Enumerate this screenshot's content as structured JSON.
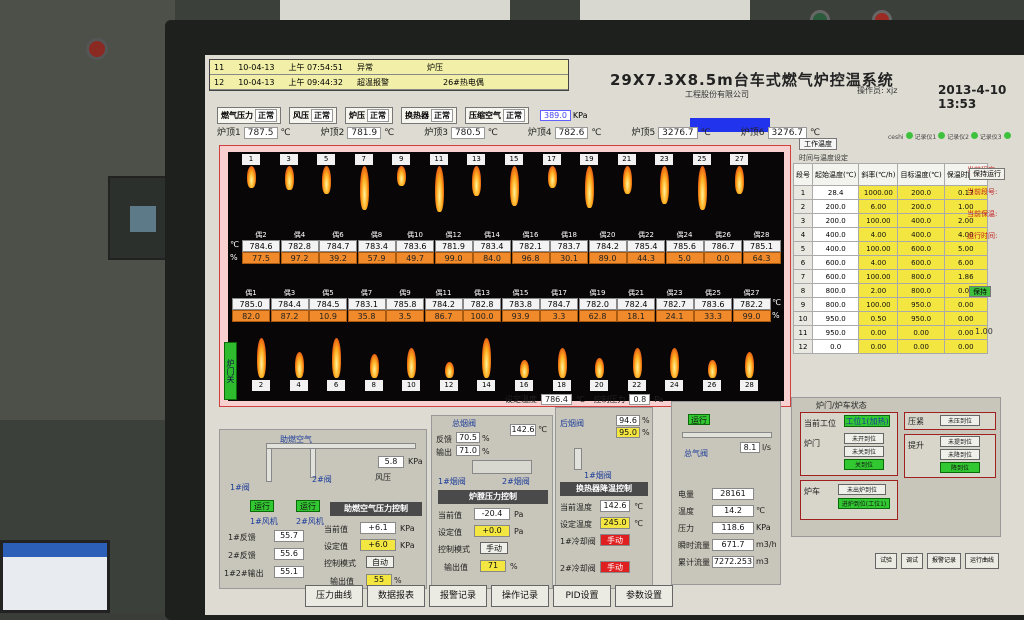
{
  "alarms": [
    {
      "no": "11",
      "date": "10-04-13",
      "time": "上午 07:54:51",
      "type": "异常",
      "source": "炉压"
    },
    {
      "no": "12",
      "date": "10-04-13",
      "time": "上午 09:44:32",
      "type": "超温报警",
      "source": "26#热电偶"
    }
  ],
  "header": {
    "title": "29X7.3X8.5m台车式燃气炉控温系统",
    "subtitle": "工程股份有限公司",
    "operator_label": "操作员:",
    "operator": "xjz",
    "datetime": "2013-4-10 13:53"
  },
  "status": [
    {
      "label": "燃气压力",
      "state": "正常"
    },
    {
      "label": "风压",
      "state": "正常"
    },
    {
      "label": "炉压",
      "state": "正常"
    },
    {
      "label": "换热器",
      "state": "正常"
    },
    {
      "label": "压缩空气",
      "state": "正常"
    }
  ],
  "kpa": {
    "value": "389.0",
    "unit": "KPa"
  },
  "zones": [
    {
      "label": "炉顶1",
      "value": "787.5",
      "unit": "℃"
    },
    {
      "label": "炉顶2",
      "value": "781.9",
      "unit": "℃"
    },
    {
      "label": "炉顶3",
      "value": "780.5",
      "unit": "℃"
    },
    {
      "label": "炉顶4",
      "value": "782.6",
      "unit": "℃"
    },
    {
      "label": "炉顶5",
      "value": "3276.7",
      "unit": "℃"
    },
    {
      "label": "炉顶6",
      "value": "3276.7",
      "unit": "℃"
    }
  ],
  "furnace": {
    "top_nozzles": [
      "1",
      "3",
      "5",
      "7",
      "9",
      "11",
      "13",
      "15",
      "17",
      "19",
      "21",
      "23",
      "25",
      "27"
    ],
    "bottom_nozzles": [
      "2",
      "4",
      "6",
      "8",
      "10",
      "12",
      "14",
      "16",
      "18",
      "20",
      "22",
      "24",
      "26",
      "28"
    ],
    "upper_tc": [
      {
        "label": "偶2",
        "t": "784.6",
        "p": "77.5"
      },
      {
        "label": "偶4",
        "t": "782.8",
        "p": "97.2"
      },
      {
        "label": "偶6",
        "t": "784.7",
        "p": "39.2"
      },
      {
        "label": "偶8",
        "t": "783.4",
        "p": "57.9"
      },
      {
        "label": "偶10",
        "t": "783.6",
        "p": "49.7"
      },
      {
        "label": "偶12",
        "t": "781.9",
        "p": "99.0"
      },
      {
        "label": "偶14",
        "t": "783.4",
        "p": "84.0"
      },
      {
        "label": "偶16",
        "t": "782.1",
        "p": "96.8"
      },
      {
        "label": "偶18",
        "t": "783.7",
        "p": "30.1"
      },
      {
        "label": "偶20",
        "t": "784.2",
        "p": "89.0"
      },
      {
        "label": "偶22",
        "t": "785.4",
        "p": "44.3"
      },
      {
        "label": "偶24",
        "t": "785.6",
        "p": "5.0"
      },
      {
        "label": "偶26",
        "t": "786.7",
        "p": "0.0"
      },
      {
        "label": "偶28",
        "t": "785.1",
        "p": "64.3"
      }
    ],
    "lower_tc": [
      {
        "label": "偶1",
        "t": "785.0",
        "p": "82.0"
      },
      {
        "label": "偶3",
        "t": "784.4",
        "p": "87.2"
      },
      {
        "label": "偶5",
        "t": "784.5",
        "p": "10.9"
      },
      {
        "label": "偶7",
        "t": "783.1",
        "p": "35.8"
      },
      {
        "label": "偶9",
        "t": "785.8",
        "p": "3.5"
      },
      {
        "label": "偶11",
        "t": "784.2",
        "p": "86.7"
      },
      {
        "label": "偶13",
        "t": "782.8",
        "p": "100.0"
      },
      {
        "label": "偶15",
        "t": "783.8",
        "p": "93.9"
      },
      {
        "label": "偶17",
        "t": "784.7",
        "p": "3.3"
      },
      {
        "label": "偶19",
        "t": "782.0",
        "p": "62.8"
      },
      {
        "label": "偶21",
        "t": "782.4",
        "p": "18.1"
      },
      {
        "label": "偶23",
        "t": "782.7",
        "p": "24.1"
      },
      {
        "label": "偶25",
        "t": "783.6",
        "p": "33.3"
      },
      {
        "label": "偶27",
        "t": "782.2",
        "p": "99.0"
      }
    ],
    "door_label": "炉门关",
    "unit_c": "℃",
    "unit_p": "%"
  },
  "set_temp": {
    "label": "设定温度",
    "value": "786.4",
    "unit": "℃",
    "press_label": "控制压力",
    "press": "0.8",
    "press_unit": "Pa"
  },
  "program": {
    "btn": "工作温度",
    "title": "时间与温度设定",
    "headers": [
      "段号",
      "起始温度(℃)",
      "斜率(℃/h)",
      "目标温度(℃)",
      "保温时间(h)"
    ],
    "rows": [
      [
        "1",
        "28.4",
        "1000.00",
        "200.0",
        "0.17"
      ],
      [
        "2",
        "200.0",
        "6.00",
        "200.0",
        "1.00"
      ],
      [
        "3",
        "200.0",
        "100.00",
        "400.0",
        "2.00"
      ],
      [
        "4",
        "400.0",
        "4.00",
        "400.0",
        "4.00"
      ],
      [
        "5",
        "400.0",
        "100.00",
        "600.0",
        "5.00"
      ],
      [
        "6",
        "600.0",
        "4.00",
        "600.0",
        "6.00"
      ],
      [
        "7",
        "600.0",
        "100.00",
        "800.0",
        "1.86"
      ],
      [
        "8",
        "800.0",
        "2.00",
        "800.0",
        "0.00"
      ],
      [
        "9",
        "800.0",
        "100.00",
        "950.0",
        "0.00"
      ],
      [
        "10",
        "950.0",
        "0.50",
        "950.0",
        "0.00"
      ],
      [
        "11",
        "950.0",
        "0.00",
        "0.00",
        "0.00"
      ],
      [
        "12",
        "0.0",
        "0.00",
        "0.00",
        "0.00"
      ]
    ],
    "side_labels": [
      "当前程序:",
      "当前段号:",
      "当前保温:",
      "运行时间:"
    ],
    "side_val": "1.00",
    "led_labels": [
      "ceshi",
      "记录仪1",
      "记录仪2",
      "记录仪3"
    ],
    "run_btn": "保持运行",
    "hold_btn": "保持"
  },
  "air": {
    "title": "助燃空气",
    "press": "5.8",
    "press_unit": "KPa",
    "press_label": "风压",
    "fan1": "1#风机",
    "fan2": "2#风机",
    "run1": "运行",
    "run2": "运行",
    "valve1": "1#阀",
    "valve2": "2#阀",
    "box_title": "助燃空气压力控制",
    "fb1_label": "1#反馈",
    "fb1": "55.7",
    "fb2_label": "2#反馈",
    "fb2": "55.6",
    "out_label": "1#2#输出",
    "out": "55.1",
    "cur_label": "当前值",
    "cur": "+6.1",
    "cur_unit": "KPa",
    "set_label": "设定值",
    "set": "+6.0",
    "set_unit": "KPa",
    "mode_label": "控制模式",
    "mode": "自动",
    "o_label": "输出值",
    "o": "55",
    "o_unit": "%"
  },
  "flue": {
    "title": "总烟阀",
    "fb_label": "反馈",
    "fb": "70.5",
    "fb_unit": "%",
    "out_label": "输出",
    "out": "71.0",
    "out_unit": "%",
    "temp": "142.6",
    "temp_unit": "℃",
    "valve": "1#烟阀",
    "valve2": "2#烟阀",
    "box_title": "炉膛压力控制",
    "cur_label": "当前值",
    "cur": "-20.4",
    "cur_unit": "Pa",
    "set_label": "设定值",
    "set": "+0.0",
    "set_unit": "Pa",
    "mode_label": "控制模式",
    "mode": "手动",
    "o_label": "输出值",
    "o": "71",
    "o_unit": "%"
  },
  "exchanger": {
    "title": "后烟阀",
    "fb": "94.6",
    "fb2": "95.0",
    "unit": "%",
    "valve": "1#烟阀",
    "box_title": "换热器降温控制",
    "cur_label": "当前温度",
    "cur": "142.6",
    "cur_unit": "℃",
    "set_label": "设定温度",
    "set": "245.0",
    "set_unit": "℃",
    "cool1_label": "1#冷却阀",
    "cool2_label": "2#冷却阀",
    "state": "手动"
  },
  "gas": {
    "run": "运行",
    "flow": "8.1",
    "flow_unit": "l/s",
    "valve": "总气阀",
    "rows": [
      {
        "label": "电量",
        "value": "28161",
        "unit": ""
      },
      {
        "label": "温度",
        "value": "14.2",
        "unit": "℃"
      },
      {
        "label": "压力",
        "value": "118.6",
        "unit": "KPa"
      },
      {
        "label": "瞬时流量",
        "value": "671.7",
        "unit": "m3/h"
      },
      {
        "label": "累计流量",
        "value": "7272.253",
        "unit": "m3"
      }
    ]
  },
  "door": {
    "title": "炉门/炉车状态",
    "mode_label": "当前工位",
    "mode": "工位1(加热)",
    "door_label": "炉门",
    "door_states": [
      "未开到位",
      "未关到位",
      "关到位"
    ],
    "car_label": "炉车",
    "car_states": [
      "未出炉到位",
      "进炉到位(工位1)"
    ],
    "seal_label": "压紧",
    "seal_states": [
      "未压到位"
    ],
    "lift_label": "提升",
    "lift_states": [
      "未提到位",
      "未降到位",
      "降到位"
    ]
  },
  "tabs": [
    "压力曲线",
    "数据报表",
    "报警记录",
    "操作记录",
    "PID设置",
    "参数设置"
  ],
  "right_btns": [
    "试验",
    "调试",
    "报警记录",
    "运行曲线"
  ]
}
